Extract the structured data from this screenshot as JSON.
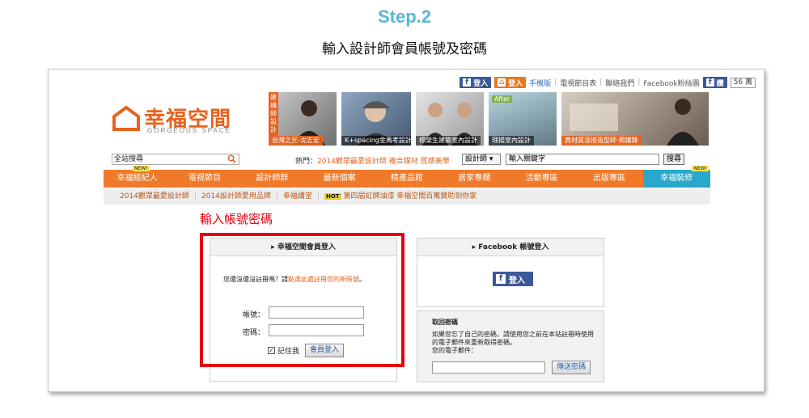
{
  "step": {
    "title": "Step.2",
    "subtitle": "輸入設計師會員帳號及密碼"
  },
  "topbar": {
    "login_fb": "登入",
    "login_home": "登入",
    "links": [
      "手機版",
      "電視節目表",
      "聯絡我們",
      "Facebook粉絲團"
    ],
    "like_label": "讚",
    "like_count": "56 萬"
  },
  "logo": {
    "name": "幸福空間",
    "en": "GORGEOUS SPACE"
  },
  "banners": {
    "b1_tag": "建構師設計",
    "b1_caption": "台灣之光-沈志宏",
    "b2_caption": "K+spacing金禹考設計",
    "b3_caption": "標榮生建築室內設計",
    "b4_tag": "After",
    "b4_caption": "理揚室內設計",
    "b5_caption": "真材質混搭造型師‧周鐘鋒"
  },
  "search": {
    "scope": "全站搜尋",
    "hot_prefix": "熱門：",
    "hot_terms": "2014觀眾最愛設計師 複合媒材 質感美學",
    "category": "設計師",
    "keyword_placeholder": "輸入關鍵字",
    "button": "搜尋"
  },
  "nav": [
    "幸福經紀人",
    "電視節目",
    "設計師群",
    "最新個案",
    "精產品館",
    "居家專欄",
    "活動專區",
    "出版專區",
    "幸福裝修"
  ],
  "nav_badge": "NEW!",
  "subnav": {
    "items": [
      "2014觀眾最愛設計師",
      "2014設計師愛用品牌",
      "幸福講堂"
    ],
    "hot_badge": "HOT",
    "hot_text": "第四屆虹牌油漆 幸福空間百萬贊助到你家"
  },
  "annotation": "輸入帳號密碼",
  "login": {
    "title": "▸ 幸福空間會員登入",
    "hint_prefix": "您還沒還沒註冊嗎？請",
    "hint_link": "點選此處註冊您的新帳號",
    "hint_suffix": "。",
    "account_label": "帳號：",
    "password_label": "密碼：",
    "remember_label": "記住我",
    "submit": "會員登入"
  },
  "facebook": {
    "title": "▸ Facebook 帳號登入",
    "button": "登入"
  },
  "recover": {
    "title": "取回密碼",
    "text": "如果您忘了自己的密碼，請使用您之前在本站註冊時使用的電子郵件來重新取得密碼。",
    "email_label": "您的電子郵件：",
    "button": "傳送密碼"
  }
}
